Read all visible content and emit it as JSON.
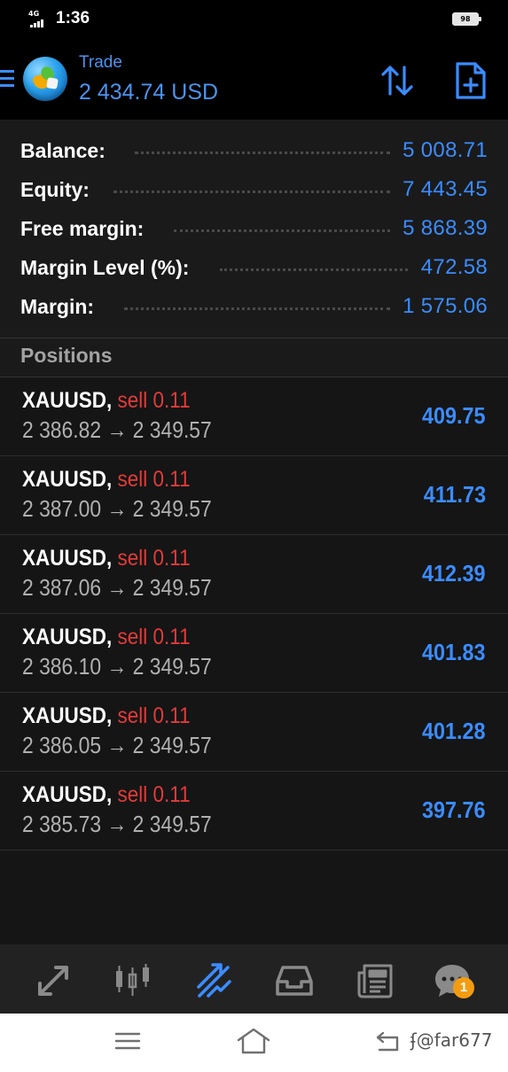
{
  "status_bar": {
    "network": "4G",
    "time": "1:36",
    "battery": "98"
  },
  "header": {
    "title": "Trade",
    "amount": "2 434.74 USD",
    "icons": [
      "menu-icon",
      "app-logo",
      "sort-icon",
      "new-order-icon"
    ]
  },
  "account": [
    {
      "label": "Balance:",
      "value": "5 008.71"
    },
    {
      "label": "Equity:",
      "value": "7 443.45"
    },
    {
      "label": "Free margin:",
      "value": "5 868.39"
    },
    {
      "label": "Margin Level (%):",
      "value": "472.58"
    },
    {
      "label": "Margin:",
      "value": "1 575.06"
    }
  ],
  "positions_header": "Positions",
  "positions": [
    {
      "symbol": "XAUUSD,",
      "side": "sell 0.11",
      "open": "2 386.82",
      "arrow": "→",
      "current": "2 349.57",
      "profit": "409.75"
    },
    {
      "symbol": "XAUUSD,",
      "side": "sell 0.11",
      "open": "2 387.00",
      "arrow": "→",
      "current": "2 349.57",
      "profit": "411.73"
    },
    {
      "symbol": "XAUUSD,",
      "side": "sell 0.11",
      "open": "2 387.06",
      "arrow": "→",
      "current": "2 349.57",
      "profit": "412.39"
    },
    {
      "symbol": "XAUUSD,",
      "side": "sell 0.11",
      "open": "2 386.10",
      "arrow": "→",
      "current": "2 349.57",
      "profit": "401.83"
    },
    {
      "symbol": "XAUUSD,",
      "side": "sell 0.11",
      "open": "2 386.05",
      "arrow": "→",
      "current": "2 349.57",
      "profit": "401.28"
    },
    {
      "symbol": "XAUUSD,",
      "side": "sell 0.11",
      "open": "2 385.73",
      "arrow": "→",
      "current": "2 349.57",
      "profit": "397.76"
    }
  ],
  "bottom_nav": {
    "items": [
      "quotes-icon",
      "chart-icon",
      "trade-icon",
      "history-icon",
      "news-icon",
      "chat-icon"
    ],
    "active": "trade-icon",
    "chat_badge": "1"
  },
  "system_nav": {
    "watermark": "@far677"
  },
  "colors": {
    "accent": "#3b8cff",
    "sell": "#e23b3b",
    "badge": "#f39c12",
    "panel": "#1a1a1a"
  }
}
